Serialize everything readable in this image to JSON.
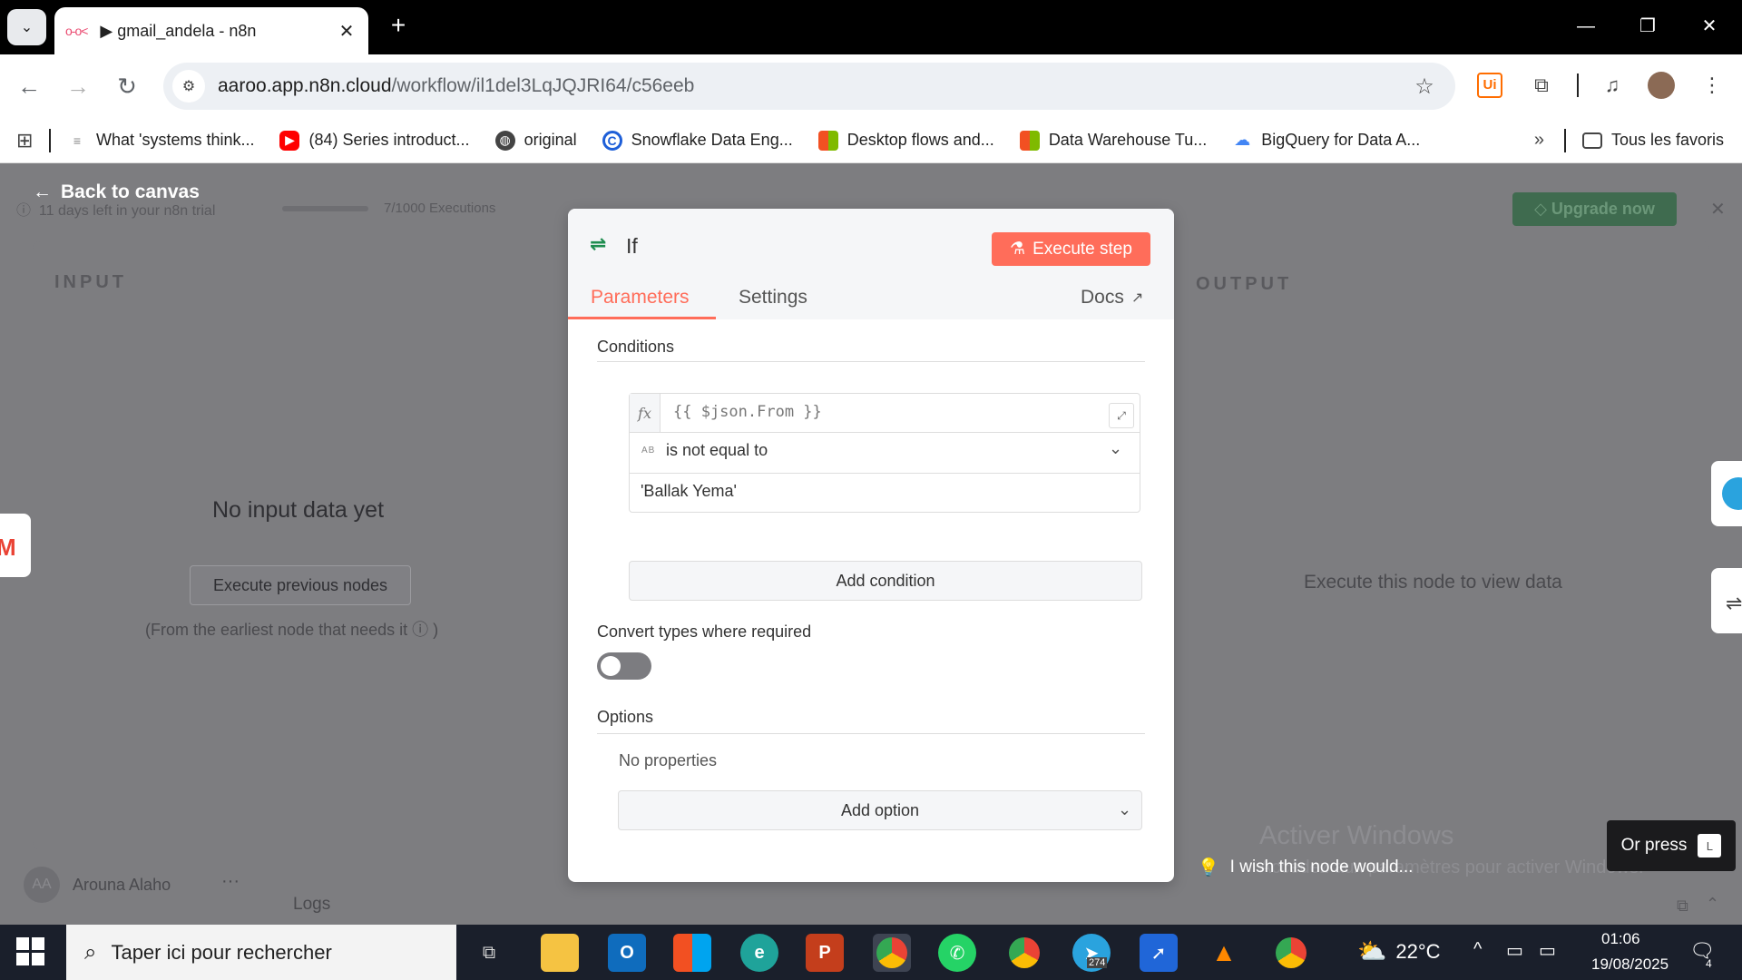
{
  "browser": {
    "tab_title": "▶ gmail_andela - n8n",
    "url_domain": "aaroo.app.n8n.cloud",
    "url_path": "/workflow/il1del3LqJQJRI64/c56eeb",
    "bookmarks": [
      {
        "label": "What 'systems think...",
        "icon": "page-icon",
        "color": "#888888"
      },
      {
        "label": "(84) Series introduct...",
        "icon": "youtube-icon",
        "color": "#ff0000"
      },
      {
        "label": "original",
        "icon": "globe-icon",
        "color": "#444444"
      },
      {
        "label": "Snowflake Data Eng...",
        "icon": "coursera-icon",
        "color": "#1e5fd8"
      },
      {
        "label": "Desktop flows and...",
        "icon": "microsoft-icon",
        "color": "#f25022"
      },
      {
        "label": "Data Warehouse Tu...",
        "icon": "microsoft-icon",
        "color": "#f25022"
      },
      {
        "label": "BigQuery for Data A...",
        "icon": "google-cloud-icon",
        "color": "#4285f4"
      }
    ],
    "all_bookmarks_label": "Tous les favoris"
  },
  "trial": {
    "days_left": "11 days left in your n8n trial",
    "executions": "7/1000 Executions",
    "upgrade_label": "Upgrade now"
  },
  "ndv": {
    "back_label": "Back to canvas",
    "input_label": "INPUT",
    "output_label": "OUTPUT",
    "no_input": "No input data yet",
    "execute_previous": "Execute previous nodes",
    "earliest_note": "(From the earliest node that needs it",
    "execute_to_view": "Execute this node to view data"
  },
  "node": {
    "name": "If",
    "execute_step": "Execute step",
    "tabs": {
      "parameters": "Parameters",
      "settings": "Settings",
      "docs": "Docs"
    },
    "conditions_label": "Conditions",
    "condition": {
      "left_value": "{{ $json.From }}",
      "type_badge": "AB",
      "operator": "is not equal to",
      "right_value": "'Ballak Yema'"
    },
    "add_condition": "Add condition",
    "convert_types_label": "Convert types where required",
    "convert_types_enabled": false,
    "options_label": "Options",
    "no_properties": "No properties",
    "add_option": "Add option"
  },
  "sidebar": {
    "user_name": "Arouna Alaho",
    "user_initials": "AA",
    "logs_label": "Logs"
  },
  "overlays": {
    "activate_title": "Activer Windows",
    "activate_sub": "Accédez aux paramètres pour activer Windows.",
    "wish_label": "I wish this node would...",
    "or_press": "Or press",
    "or_press_key": "L"
  },
  "taskbar": {
    "search_placeholder": "Taper ici pour rechercher",
    "weather_temp": "22°C",
    "time": "01:06",
    "date": "19/08/2025",
    "telegram_badge": "274",
    "notification_count": "4"
  },
  "colors": {
    "accent": "#ff6d5a",
    "node_green": "#1e8d4f"
  }
}
